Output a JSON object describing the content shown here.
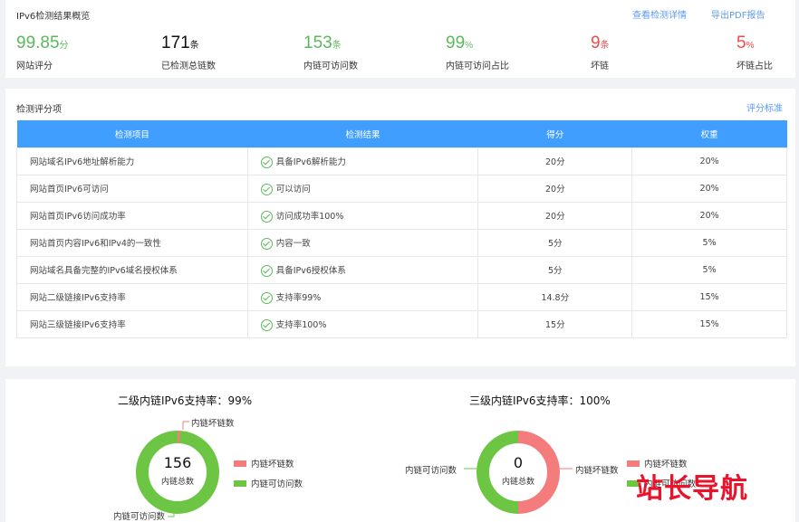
{
  "overview": {
    "title": "IPv6检测结果概览",
    "link_detail": "查看检测详情",
    "link_pdf": "导出PDF报告",
    "stats": [
      {
        "value": "99.85",
        "unit": "分",
        "label": "网站评分",
        "color": "#5cb85c"
      },
      {
        "value": "171",
        "unit": "条",
        "label": "已检测总链数",
        "color": "#111111"
      },
      {
        "value": "153",
        "unit": "条",
        "label": "内链可访问数",
        "color": "#5cb85c"
      },
      {
        "value": "99",
        "unit": "%",
        "label": "内链可访问占比",
        "color": "#5cb85c"
      },
      {
        "value": "9",
        "unit": "条",
        "label": "坏链",
        "color": "#f04a4a"
      },
      {
        "value": "5",
        "unit": "%",
        "label": "坏链占比",
        "color": "#f04a4a"
      }
    ]
  },
  "scoring": {
    "title": "检测评分项",
    "link_standard": "评分标准",
    "headers": [
      "检测项目",
      "检测结果",
      "得分",
      "权重"
    ],
    "rows": [
      {
        "item": "网站域名IPv6地址解析能力",
        "result": "具备IPv6解析能力",
        "score": "20分",
        "weight": "20%"
      },
      {
        "item": "网站首页IPv6可访问",
        "result": "可以访问",
        "score": "20分",
        "weight": "20%"
      },
      {
        "item": "网站首页IPv6访问成功率",
        "result": "访问成功率100%",
        "score": "20分",
        "weight": "20%"
      },
      {
        "item": "网站首页内容IPv6和IPv4的一致性",
        "result": "内容一致",
        "score": "5分",
        "weight": "5%"
      },
      {
        "item": "网站域名具备完整的IPv6域名授权体系",
        "result": "具备IPv6授权体系",
        "score": "5分",
        "weight": "5%"
      },
      {
        "item": "网站二级链接IPv6支持率",
        "result": "支持率99%",
        "score": "14.8分",
        "weight": "15%"
      },
      {
        "item": "网站三级链接IPv6支持率",
        "result": "支持率100%",
        "score": "15分",
        "weight": "15%"
      }
    ]
  },
  "charts": {
    "left": {
      "title": "二级内链IPv6支持率：99%",
      "total": "156",
      "total_label": "内链总数",
      "broken_label": "内链坏链数",
      "ok_label": "内链可访问数",
      "legend_broken": "内链坏链数",
      "legend_ok": "内链可访问数"
    },
    "right": {
      "title": "三级内链IPv6支持率：100%",
      "total": "0",
      "total_label": "内链总数",
      "broken_label": "内链坏链数",
      "ok_label": "内链可访问数",
      "legend_broken": "内链坏链数",
      "legend_ok": "内链可访问数"
    },
    "colors": {
      "ok": "#6cc644",
      "broken": "#f47c7c"
    }
  },
  "watermark": "站长导航"
}
